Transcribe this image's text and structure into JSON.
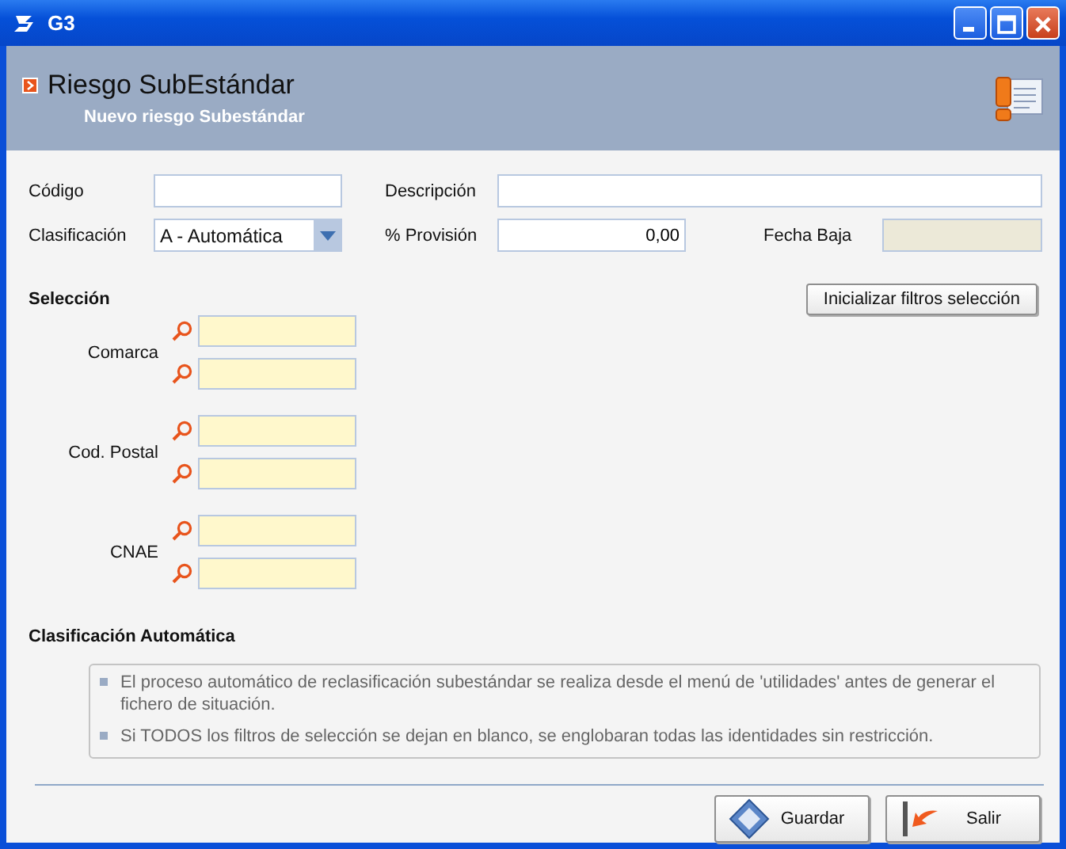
{
  "window": {
    "title": "G3"
  },
  "header": {
    "title": "Riesgo SubEstándar",
    "subtitle": "Nuevo riesgo Subestándar"
  },
  "form": {
    "codigo": {
      "label": "Código"
    },
    "descripcion": {
      "label": "Descripción"
    },
    "clasificacion": {
      "label": "Clasificación",
      "value": "A - Automática"
    },
    "provision": {
      "label": "% Provisión",
      "value": "0,00"
    },
    "fecha_baja": {
      "label": "Fecha Baja",
      "disabled": true
    }
  },
  "seleccion": {
    "title": "Selección",
    "reset_button": "Inicializar filtros selección",
    "groups": [
      {
        "label": "Comarca"
      },
      {
        "label": "Cod. Postal"
      },
      {
        "label": "CNAE"
      }
    ]
  },
  "auto": {
    "title": "Clasificación Automática",
    "notes": [
      "El proceso automático de reclasificación subestándar se realiza desde el menú de 'utilidades' antes de generar el fichero de situación.",
      "Si TODOS los filtros de selección se dejan en blanco, se englobaran todas las identidades sin restricción."
    ]
  },
  "buttons": [
    {
      "label": "Guardar",
      "kind": "save"
    },
    {
      "label": "Salir",
      "kind": "exit"
    }
  ]
}
